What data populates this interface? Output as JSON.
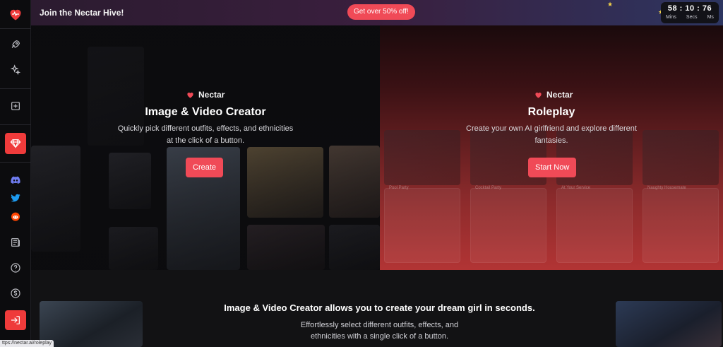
{
  "banner": {
    "title": "Join the Nectar Hive!",
    "cta": "Get over 50% off!",
    "timer": {
      "minutes": "58",
      "seconds": "10",
      "ms": "76",
      "labels": [
        "Mins",
        "Secs",
        "Ms"
      ]
    }
  },
  "sidebar": {
    "items": [
      {
        "name": "heart-logo-icon",
        "label": "Nectar"
      },
      {
        "name": "rocket-icon",
        "label": "Launch"
      },
      {
        "name": "sparkles-icon",
        "label": "Effects"
      },
      {
        "name": "plus-square-icon",
        "label": "Create"
      },
      {
        "name": "gem-icon",
        "label": "Premium"
      },
      {
        "name": "discord-icon",
        "label": "Discord"
      },
      {
        "name": "twitter-icon",
        "label": "Twitter"
      },
      {
        "name": "reddit-icon",
        "label": "Reddit"
      },
      {
        "name": "news-icon",
        "label": "Blog"
      },
      {
        "name": "help-icon",
        "label": "Help"
      },
      {
        "name": "dollar-icon",
        "label": "Pricing"
      },
      {
        "name": "login-icon",
        "label": "Login"
      }
    ]
  },
  "hero": {
    "left": {
      "brand": "Nectar",
      "title": "Image & Video Creator",
      "subtitle_line1": "Quickly pick different outfits, effects, and ethnicities",
      "subtitle_line2": "at the click of a button.",
      "button": "Create"
    },
    "right": {
      "brand": "Nectar",
      "title": "Roleplay",
      "subtitle_line1": "Create your own AI girlfriend and explore different",
      "subtitle_line2": "fantasies.",
      "button": "Start Now",
      "cards": [
        "Pool Party",
        "Cocktail Party",
        "At Your Service",
        "Naughty Housemate"
      ]
    }
  },
  "bottom": {
    "title": "Image & Video Creator allows you to create your dream girl in seconds.",
    "subtitle_line1": "Effortlessly select different outfits, effects, and",
    "subtitle_line2": "ethnicities with a single click of a button."
  },
  "statusbar": {
    "url": "ttps://nectar.ai/roleplay"
  },
  "colors": {
    "accent": "#f04a57",
    "sidebar_bg": "#0c0c0e",
    "page_bg": "#121214"
  }
}
